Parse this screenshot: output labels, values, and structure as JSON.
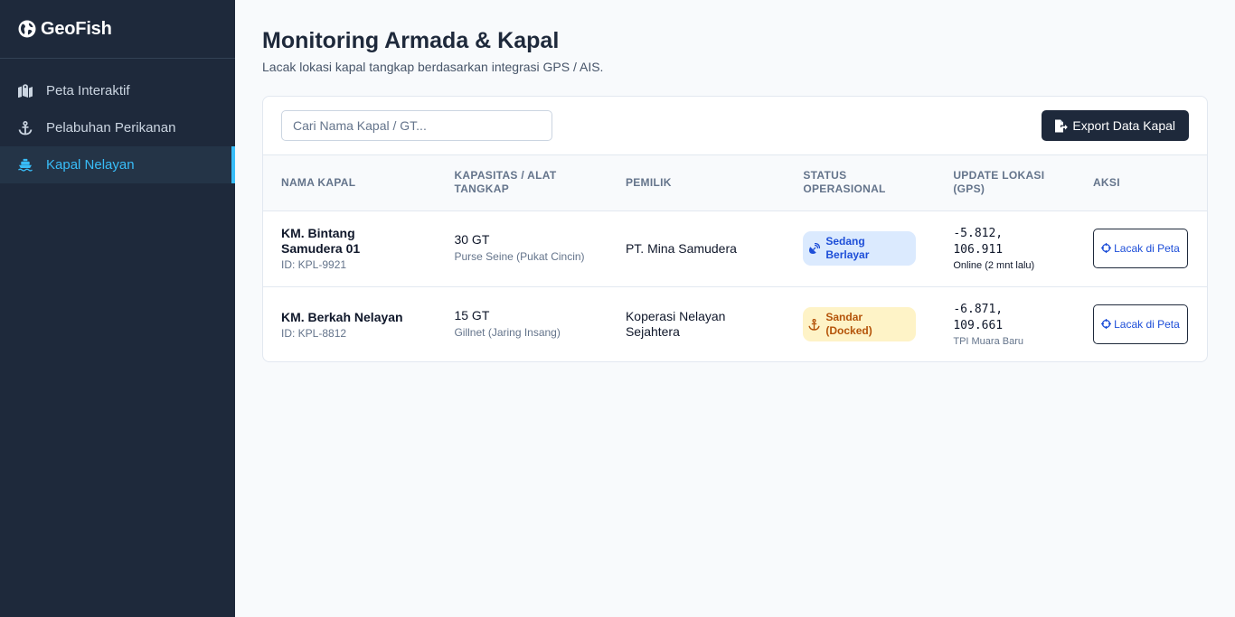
{
  "brand": {
    "name": "GeoFish"
  },
  "sidebar": {
    "items": [
      {
        "label": "Peta Interaktif",
        "icon": "map-icon"
      },
      {
        "label": "Pelabuhan Perikanan",
        "icon": "anchor-icon"
      },
      {
        "label": "Kapal Nelayan",
        "icon": "ship-icon",
        "active": true
      }
    ]
  },
  "header": {
    "title": "Monitoring Armada & Kapal",
    "subtitle": "Lacak lokasi kapal tangkap berdasarkan integrasi GPS / AIS."
  },
  "toolbar": {
    "search_placeholder": "Cari Nama Kapal / GT...",
    "export_label": "Export Data Kapal"
  },
  "table": {
    "columns": [
      "NAMA KAPAL",
      "KAPASITAS / ALAT TANGKAP",
      "PEMILIK",
      "STATUS OPERASIONAL",
      "UPDATE LOKASI (GPS)",
      "AKSI"
    ],
    "rows": [
      {
        "name": "KM. Bintang Samudera 01",
        "id": "ID: KPL-9921",
        "capacity": "30 GT",
        "gear": "Purse Seine (Pukat Cincin)",
        "owner": "PT. Mina Samudera",
        "status": "Sedang Berlayar",
        "lat": "-5.812,",
        "lon": "106.911",
        "gps_note": "Online (2 mnt lalu)",
        "action": "Lacak di Peta"
      },
      {
        "name": "KM. Berkah Nelayan",
        "id": "ID: KPL-8812",
        "capacity": "15 GT",
        "gear": "Gillnet (Jaring Insang)",
        "owner": "Koperasi Nelayan Sejahtera",
        "status": "Sandar (Docked)",
        "lat": "-6.871,",
        "lon": "109.661",
        "gps_note": "TPI Muara Baru",
        "action": "Lacak di Peta"
      }
    ]
  },
  "colors": {
    "sidebar_bg": "#1e293b",
    "accent": "#38bdf8",
    "sailing_badge_bg": "#dbeafe",
    "sailing_badge_text": "#1d4ed8",
    "docked_badge_bg": "#fef3c7",
    "docked_badge_text": "#b45309"
  }
}
